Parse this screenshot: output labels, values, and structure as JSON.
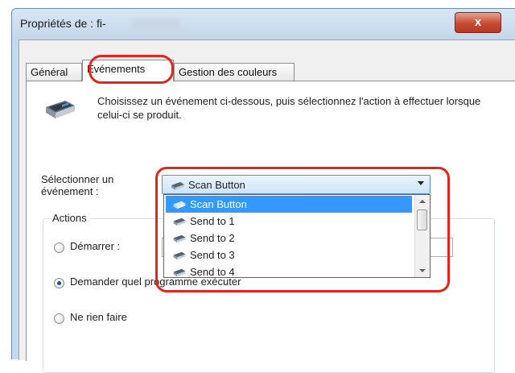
{
  "window": {
    "title": "Propriétés de : fi-",
    "close_label": "x"
  },
  "tabs": [
    {
      "label": "Général",
      "active": false
    },
    {
      "label": "Événements",
      "active": true
    },
    {
      "label": "Gestion des couleurs",
      "active": false
    }
  ],
  "events_tab": {
    "description": "Choisissez un événement ci-dessous, puis sélectionnez l'action à effectuer lorsque celui-ci se produit.",
    "select_event_label": "Sélectionner un événement :",
    "selected_event": "Scan Button",
    "event_options": [
      "Scan Button",
      "Send to 1",
      "Send to 2",
      "Send to 3",
      "Send to 4"
    ],
    "actions_group_title": "Actions",
    "actions": [
      {
        "label": "Démarrer :",
        "checked": false
      },
      {
        "label": "Demander quel programme exécuter",
        "checked": true
      },
      {
        "label": "Ne rien faire",
        "checked": false
      }
    ]
  },
  "colors": {
    "highlight": "#e0261f",
    "selection": "#3399ff",
    "close_button": "#c74b32"
  }
}
